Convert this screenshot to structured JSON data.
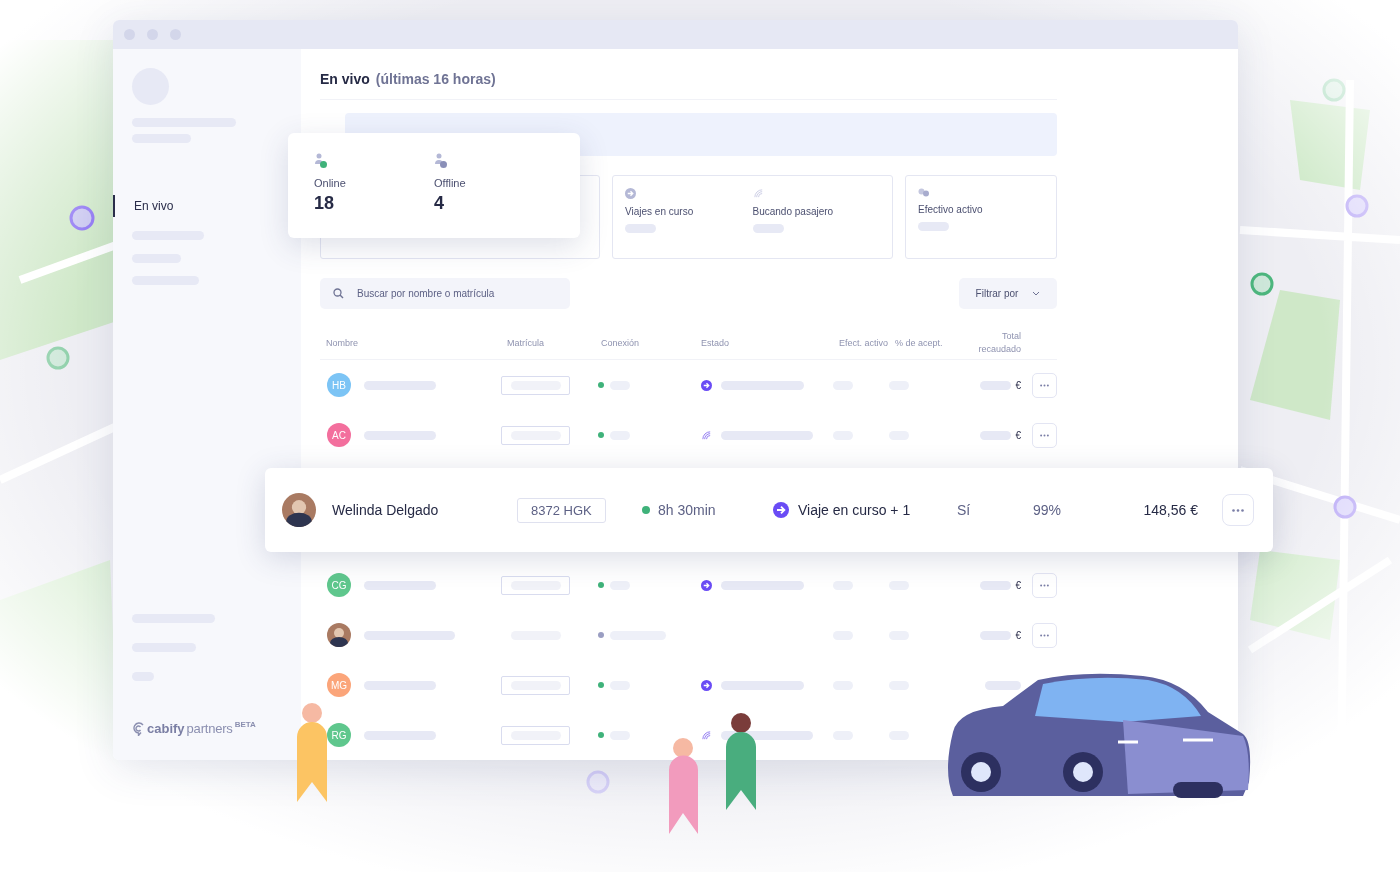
{
  "sidebar": {
    "nav_items": [
      {
        "label": "En vivo",
        "selected": true
      }
    ],
    "logo": {
      "brand": "cabify",
      "product": "partners",
      "badge": "BETA"
    }
  },
  "header": {
    "title": "En vivo",
    "subtitle": "(últimas 16 horas)"
  },
  "driver_summary": [
    {
      "label": "Online",
      "value": "18",
      "online": true
    },
    {
      "label": "Offline",
      "value": "4",
      "online": false
    }
  ],
  "trip_stats": [
    {
      "label": "Viajes en curso"
    },
    {
      "label": "Bucando pasajero"
    }
  ],
  "cash_stat": {
    "label": "Efectivo activo"
  },
  "search": {
    "placeholder": "Buscar por nombre o matrícula"
  },
  "filter": {
    "label": "Filtrar por"
  },
  "table": {
    "columns": [
      "Nombre",
      "Matrícula",
      "Conexión",
      "Estado",
      "Efect. activo",
      "% de acept.",
      "Total recaudado"
    ],
    "rows": [
      {
        "kind": "driver",
        "initials": "HB",
        "color": "#7cc4f5",
        "plate_assigned": true,
        "online": true,
        "on_trip": true,
        "searching": false,
        "currency": "€",
        "more_button": true
      },
      {
        "kind": "driver",
        "initials": "AC",
        "color": "#f36f9d",
        "plate_assigned": true,
        "online": true,
        "on_trip": false,
        "searching": true,
        "currency": "€",
        "more_button": true
      },
      {
        "kind": "featured",
        "name": "Welinda Delgado",
        "plate": "8372 HGK",
        "online": true,
        "connected_time": "8h 30min",
        "on_trip": true,
        "status_label": "Viaje en curso + 1",
        "cash": "Sí",
        "acceptance": "99%",
        "total": "148,56 €"
      },
      {
        "kind": "driver",
        "initials": "CG",
        "color": "#5fc78d",
        "plate_assigned": true,
        "online": true,
        "on_trip": true,
        "searching": false,
        "currency": "€",
        "more_button": true
      },
      {
        "kind": "driver",
        "photo": true,
        "plate_assigned": false,
        "online": false,
        "on_trip": false,
        "searching": false,
        "currency": "€",
        "more_button": true
      },
      {
        "kind": "driver",
        "initials": "MG",
        "color": "#fba57a",
        "plate_assigned": true,
        "online": true,
        "on_trip": true,
        "searching": false,
        "more_button": false
      },
      {
        "kind": "driver",
        "initials": "RG",
        "color": "#5fc78d",
        "plate_assigned": true,
        "online": true,
        "on_trip": false,
        "searching": true,
        "more_button": false,
        "total_bar": false
      }
    ]
  }
}
